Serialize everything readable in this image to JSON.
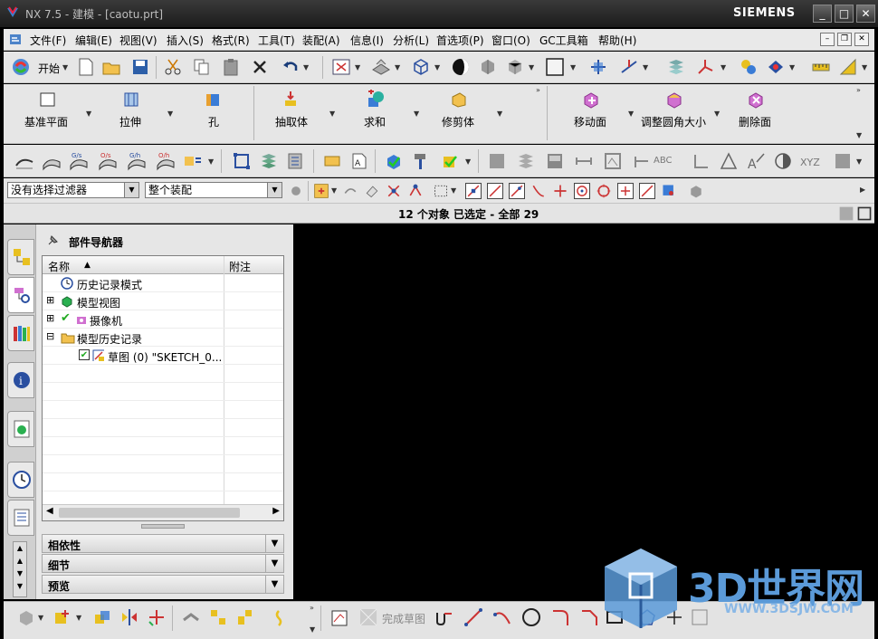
{
  "window": {
    "title": "NX 7.5 - 建模 - [caotu.prt]",
    "brand": "SIEMENS",
    "buttons": [
      "_",
      "□",
      "✕"
    ]
  },
  "menubar": {
    "items": [
      "文件(F)",
      "编辑(E)",
      "视图(V)",
      "插入(S)",
      "格式(R)",
      "工具(T)",
      "装配(A)",
      "信息(I)",
      "分析(L)",
      "首选项(P)",
      "窗口(O)",
      "GC工具箱",
      "帮助(H)"
    ]
  },
  "toolbar1": {
    "start_label": "开始"
  },
  "toolbar2": {
    "buttons": [
      "基准平面",
      "拉伸",
      "孔",
      "抽取体",
      "求和",
      "修剪体",
      "移动面",
      "调整圆角大小",
      "删除面"
    ]
  },
  "toolbar3": {
    "abc_label": "ABC",
    "xyz_label": "XYZ"
  },
  "filterbar": {
    "selection_filter": "没有选择过滤器",
    "assembly_scope": "整个装配"
  },
  "status": {
    "message": "12 个对象 已选定  - 全部 29"
  },
  "navigator": {
    "title": "部件导航器",
    "columns": [
      "名称",
      "附注"
    ],
    "rows": [
      {
        "label": "历史记录模式",
        "expander": ""
      },
      {
        "label": "模型视图",
        "expander": "⊞"
      },
      {
        "label": "摄像机",
        "expander": "⊞"
      },
      {
        "label": "模型历史记录",
        "expander": "⊟"
      },
      {
        "label": "草图 (0) \"SKETCH_0...",
        "expander": ""
      }
    ],
    "sections": [
      "相依性",
      "细节",
      "预览"
    ]
  },
  "bottom_toolbar": {
    "finish_sketch_label": "完成草图"
  },
  "watermark": {
    "text": "3D世界网",
    "url": "WWW.3DSJW.COM"
  },
  "colors": {
    "titlebar": "#1c1c1c",
    "toolbar": "#e6e6e6",
    "graphics": "#000000",
    "watermark": "#5b9ad8"
  }
}
